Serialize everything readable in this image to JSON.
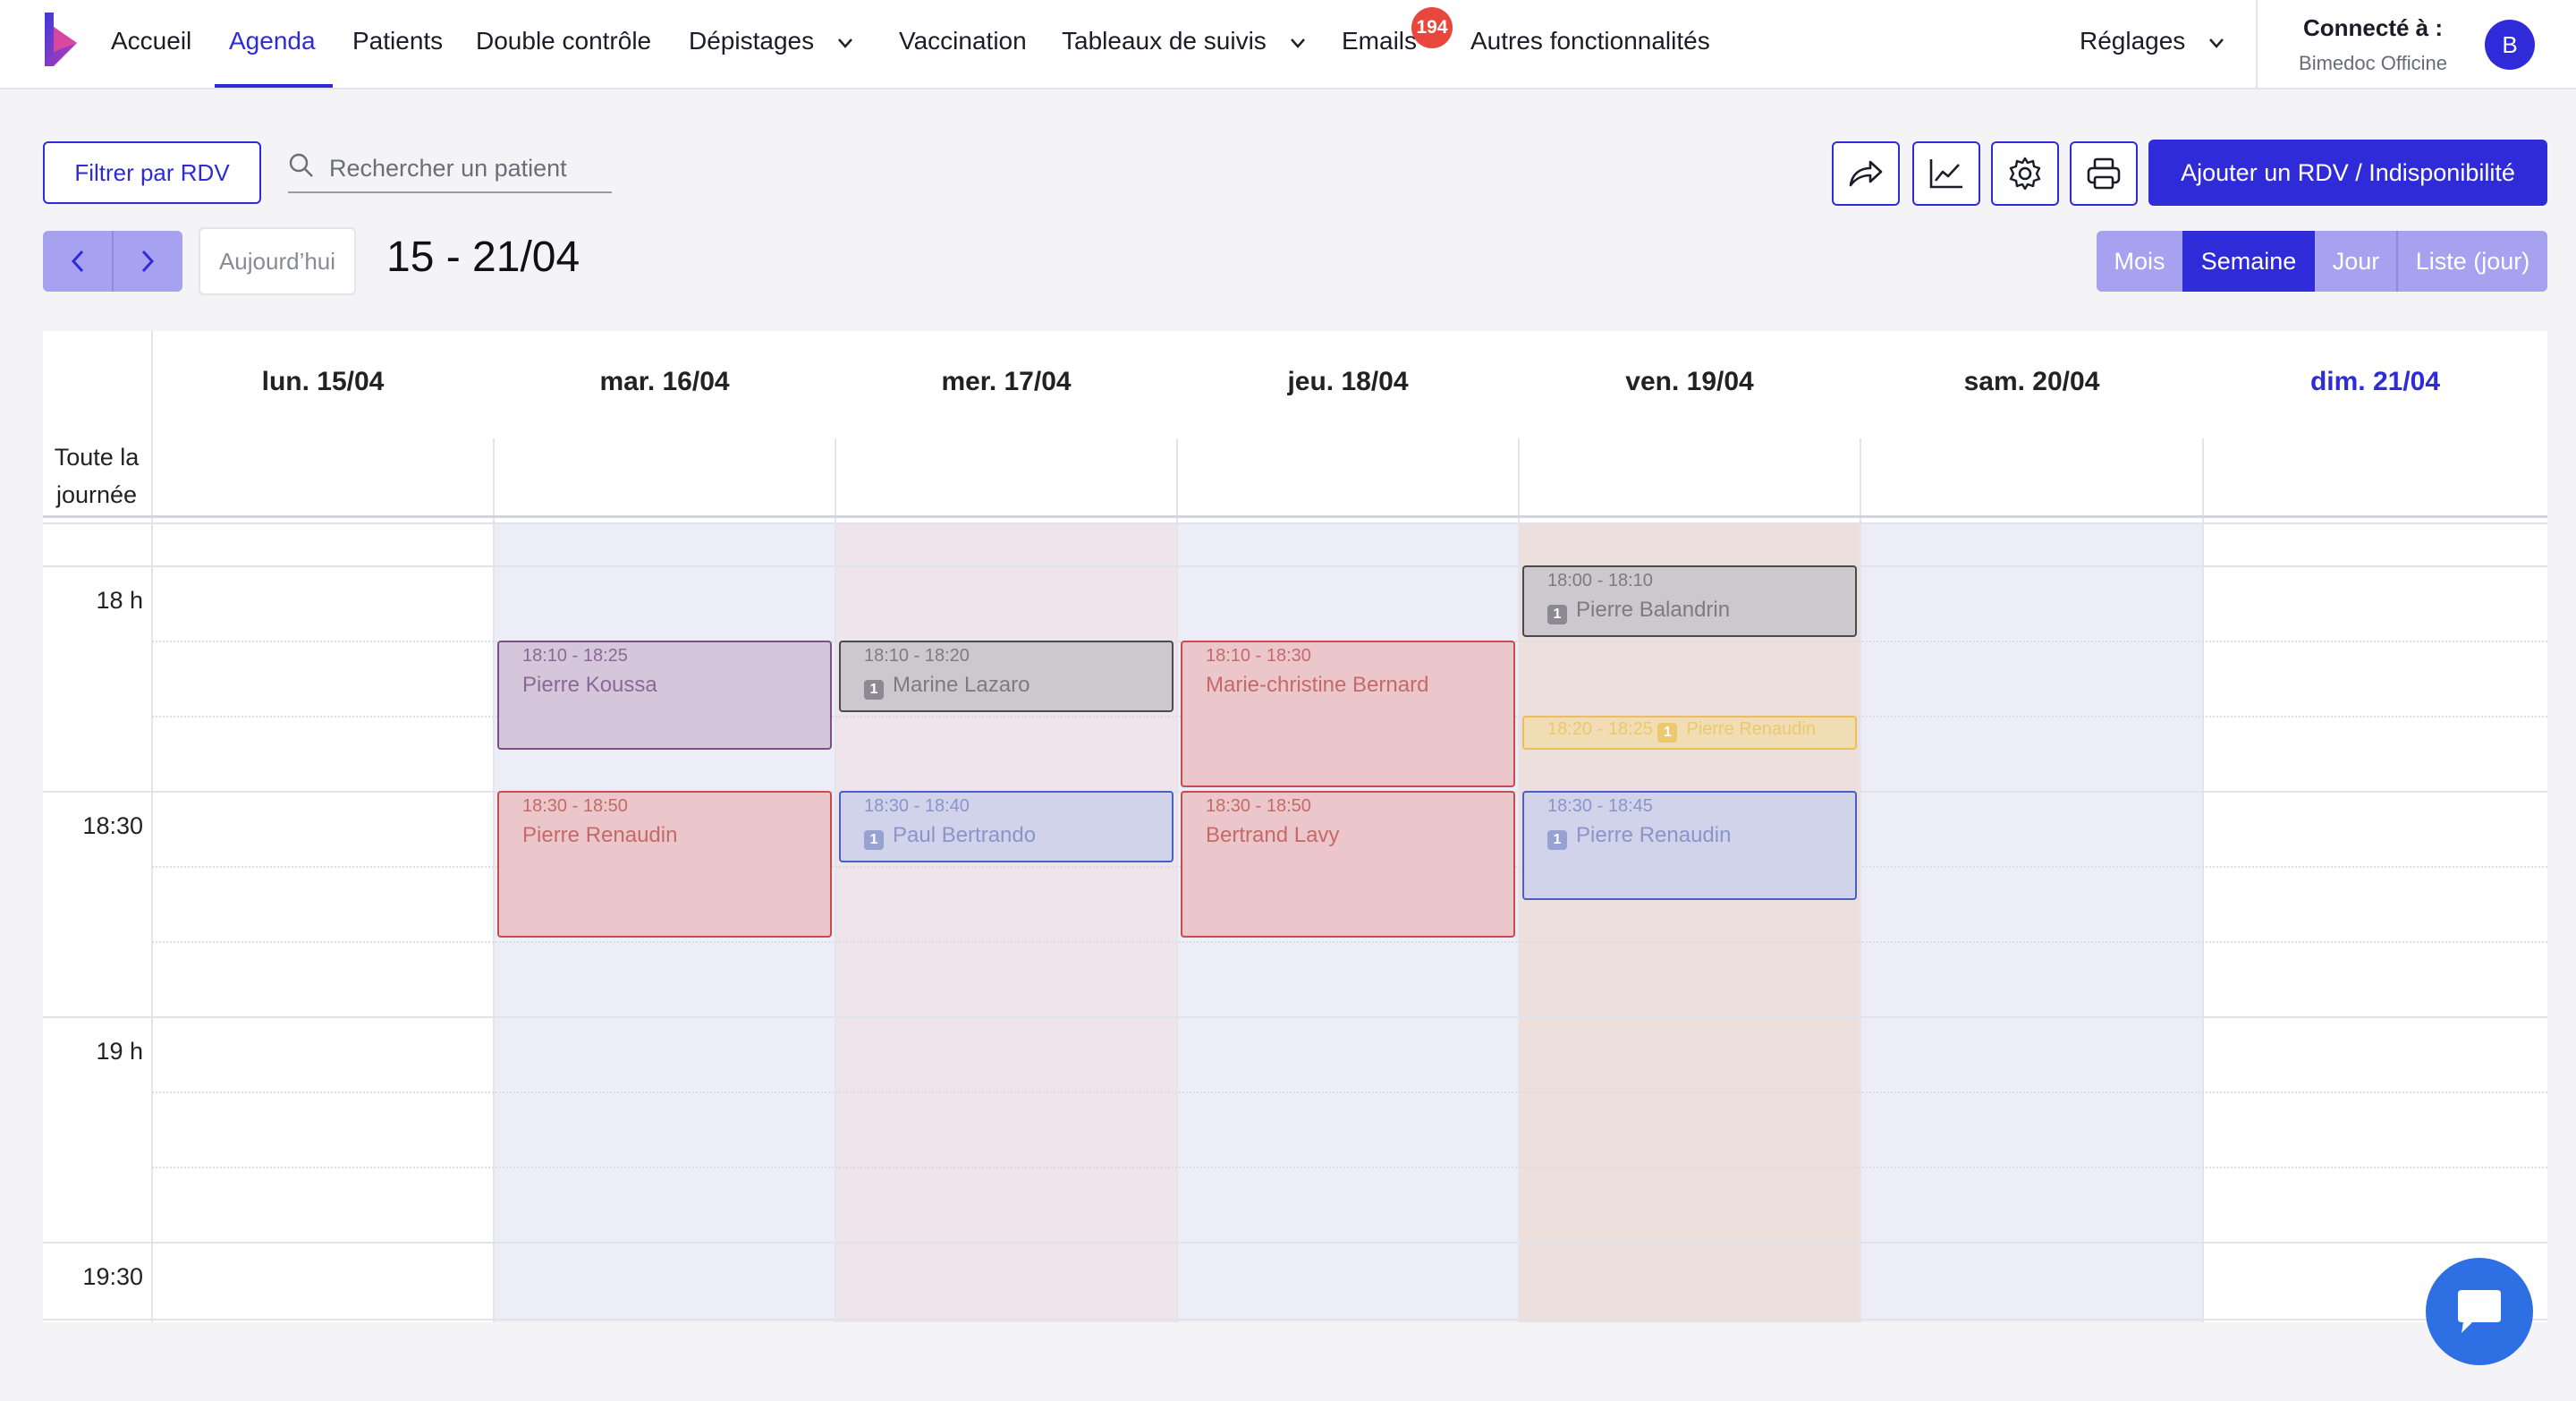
{
  "nav": {
    "items": [
      "Accueil",
      "Agenda",
      "Patients",
      "Double contrôle",
      "Dépistages",
      "Vaccination",
      "Tableaux de suivis",
      "Emails",
      "Autres fonctionnalités"
    ],
    "active": "Agenda",
    "emails_badge": "194",
    "settings": "Réglages",
    "connected_label": "Connecté à :",
    "connected_value": "Bimedoc Officine",
    "avatar_initial": "B"
  },
  "toolbar": {
    "filter_label": "Filtrer par RDV",
    "search_placeholder": "Rechercher un patient",
    "action_icons": [
      "share-icon",
      "chart-icon",
      "gear-icon",
      "printer-icon"
    ],
    "add_label": "Ajouter un RDV / Indisponibilité",
    "today_label": "Aujourd’hui",
    "range_title": "15 - 21/04",
    "views": [
      "Mois",
      "Semaine",
      "Jour",
      "Liste (jour)"
    ],
    "active_view": "Semaine"
  },
  "calendar": {
    "allday_label": "Toute la journée",
    "days": [
      "lun. 15/04",
      "mar. 16/04",
      "mer. 17/04",
      "jeu. 18/04",
      "ven. 19/04",
      "sam. 20/04",
      "dim. 21/04"
    ],
    "today": "dim. 21/04",
    "time_labels": [
      "18 h",
      "18:30",
      "19 h",
      "19:30"
    ],
    "events": [
      {
        "day": 1,
        "start": "18:10",
        "end": "18:25",
        "time": "18:10 - 18:25",
        "name": "Pierre Koussa",
        "style": "purple",
        "badge": false
      },
      {
        "day": 1,
        "start": "18:30",
        "end": "18:50",
        "time": "18:30 - 18:50",
        "name": "Pierre Renaudin",
        "style": "red",
        "badge": false
      },
      {
        "day": 2,
        "start": "18:10",
        "end": "18:20",
        "time": "18:10 - 18:20",
        "name": "Marine Lazaro",
        "style": "gray",
        "badge": true
      },
      {
        "day": 2,
        "start": "18:30",
        "end": "18:40",
        "time": "18:30 - 18:40",
        "name": "Paul Bertrando",
        "style": "blue",
        "badge": true
      },
      {
        "day": 3,
        "start": "18:10",
        "end": "18:30",
        "time": "18:10 - 18:30",
        "name": "Marie-christine Bernard",
        "style": "red",
        "badge": false
      },
      {
        "day": 3,
        "start": "18:30",
        "end": "18:50",
        "time": "18:30 - 18:50",
        "name": "Bertrand Lavy",
        "style": "red",
        "badge": false
      },
      {
        "day": 4,
        "start": "18:00",
        "end": "18:10",
        "time": "18:00 - 18:10",
        "name": "Pierre Balandrin",
        "style": "gray",
        "badge": true
      },
      {
        "day": 4,
        "start": "18:20",
        "end": "18:25",
        "time": "18:20 - 18:25",
        "name": "Pierre Renaudin",
        "style": "yellow",
        "badge": true,
        "inline": true
      },
      {
        "day": 4,
        "start": "18:30",
        "end": "18:45",
        "time": "18:30 - 18:45",
        "name": "Pierre Renaudin",
        "style": "blue",
        "badge": true
      }
    ],
    "badge_glyph": "1"
  },
  "colors": {
    "accent": "#2f2bd9",
    "badge_red": "#e9473e",
    "chat_blue": "#2f6fe4"
  }
}
